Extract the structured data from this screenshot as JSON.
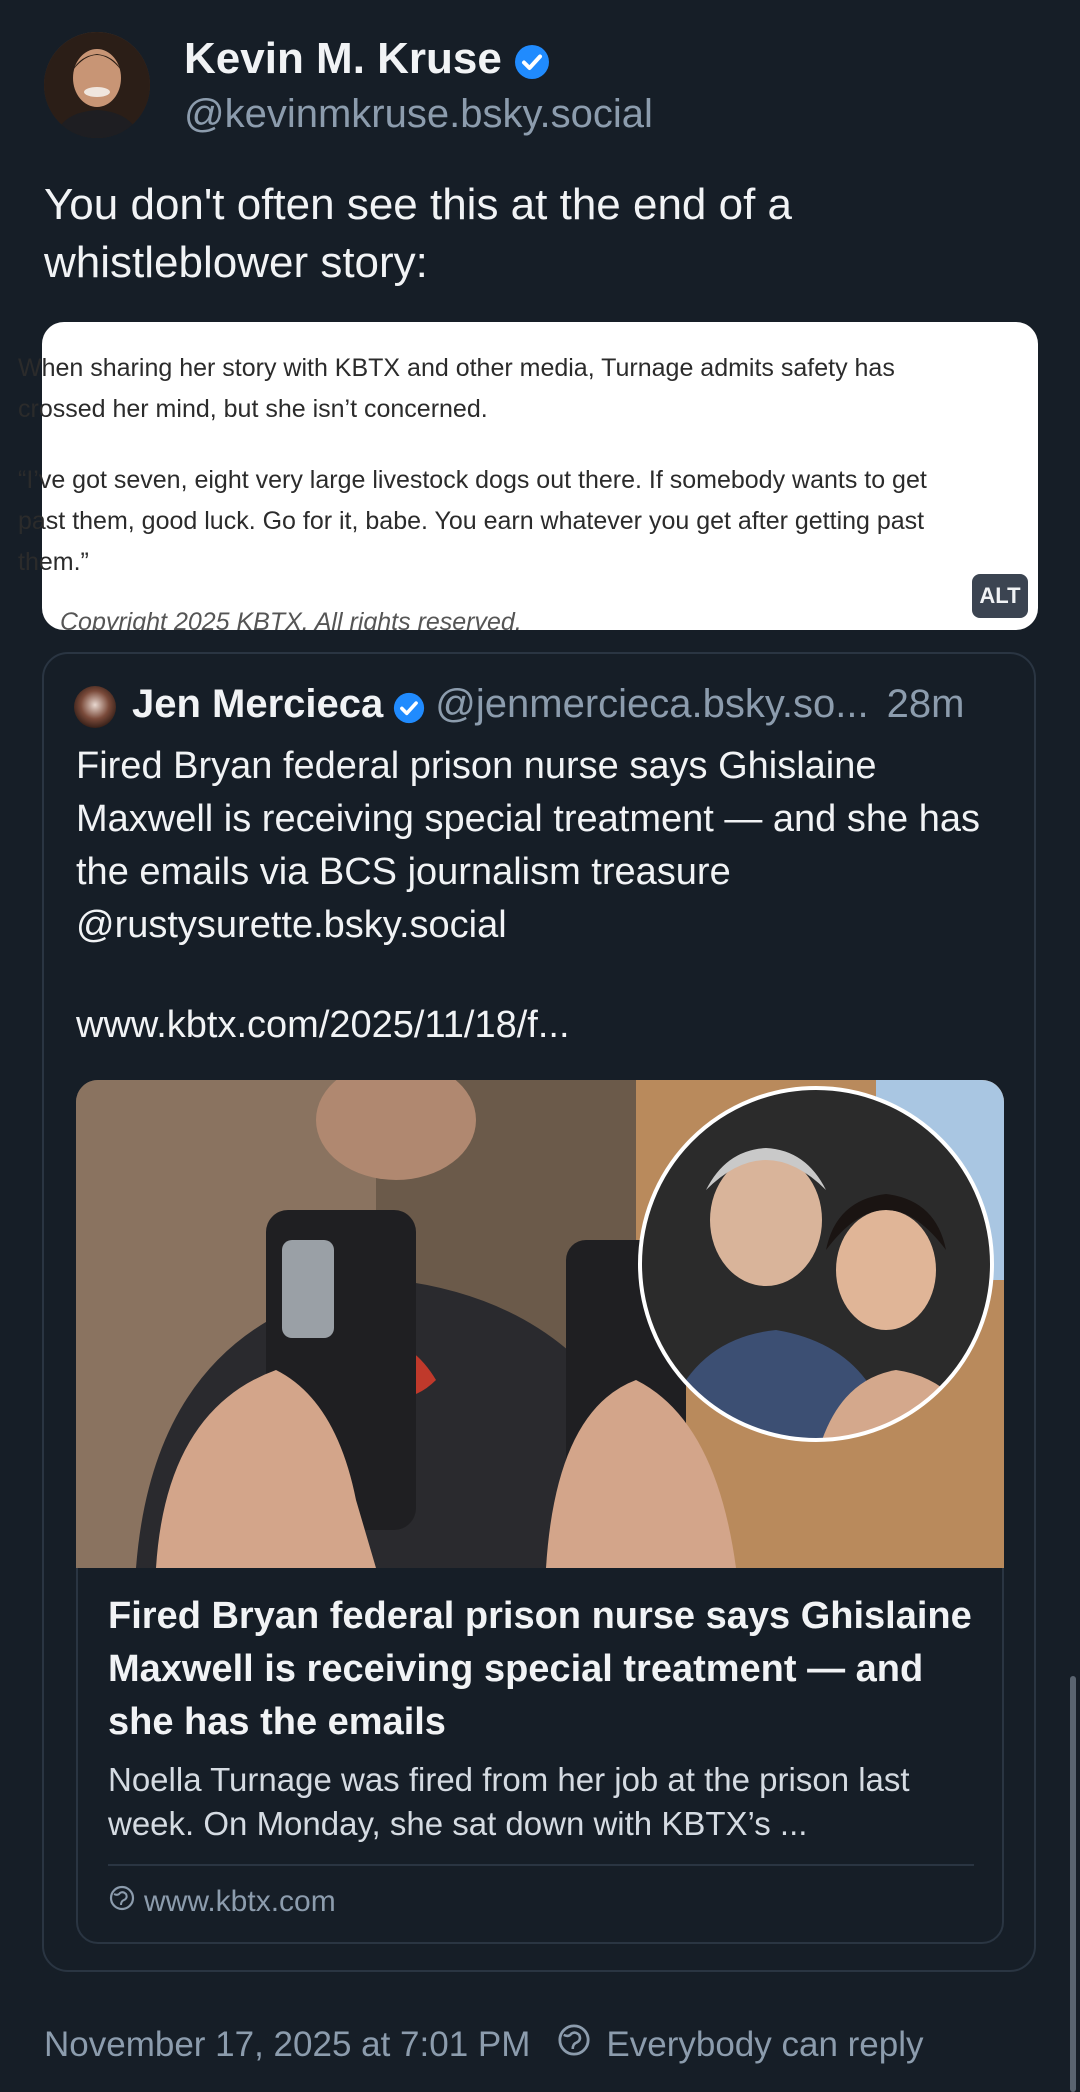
{
  "author": {
    "name": "Kevin M. Kruse",
    "handle": "@kevinmkruse.bsky.social",
    "verified": true
  },
  "post": {
    "text": "You don't often see this at the end of a whistleblower story:"
  },
  "screenshot_image": {
    "paragraph1": "When sharing her story with KBTX and other media, Turnage admits safety has crossed her mind, but she isn’t concerned.",
    "paragraph2": "“I’ve got seven, eight very large livestock dogs out there. If somebody wants to get past them, good luck. Go for it, babe. You earn whatever you get after getting past them.”",
    "copyright": "Copyright 2025 KBTX. All rights reserved.",
    "alt_label": "ALT"
  },
  "quote": {
    "name": "Jen Mercieca",
    "handle": "@jenmercieca.bsky.so...",
    "time": "28m",
    "text": "Fired Bryan federal prison nurse says Ghislaine Maxwell is receiving special treatment — and she has the emails via BCS journalism treasure @rustysurette.bsky.social",
    "link": "www.kbtx.com/2025/11/18/f..."
  },
  "link_card": {
    "title": "Fired Bryan federal prison nurse says Ghislaine Maxwell is receiving special treatment — and she has the emails",
    "description": "Noella Turnage was fired from her job at the prison last week. On Monday, she sat down with KBTX’s ...",
    "domain": "www.kbtx.com",
    "domain_icon": "globe-icon"
  },
  "footer": {
    "timestamp": "November 17, 2025 at 7:01 PM",
    "reply_setting": "Everybody can reply",
    "reply_icon": "globe-icon"
  },
  "colors": {
    "background": "#161e27",
    "secondary_text": "#8c9cad",
    "verified_blue": "#208bfe",
    "border": "#2a3542"
  }
}
